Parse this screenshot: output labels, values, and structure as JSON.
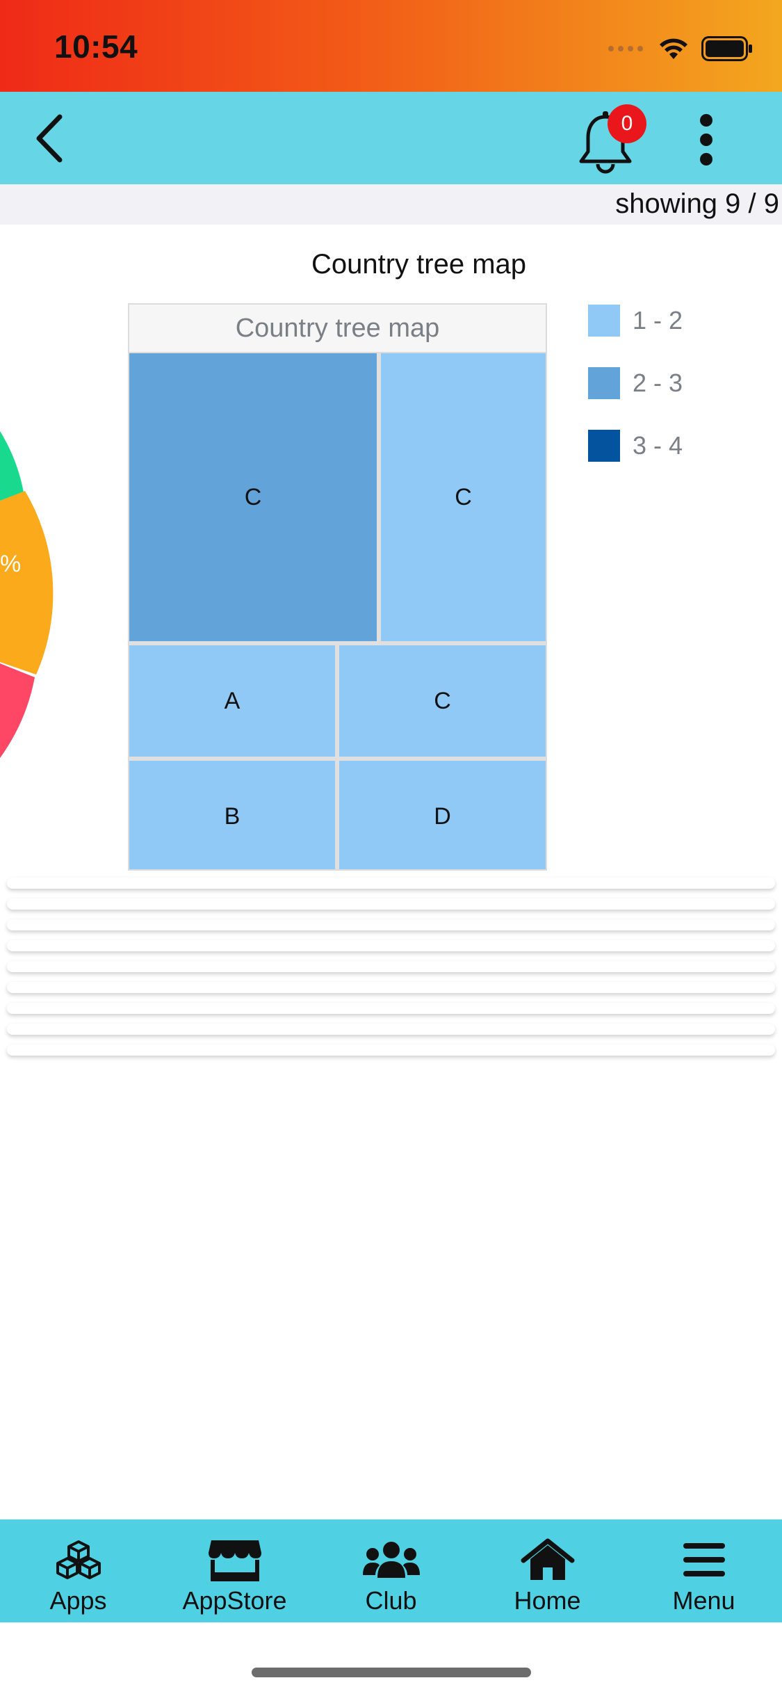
{
  "status_bar": {
    "time": "10:54"
  },
  "header": {
    "notification_count": "0"
  },
  "list": {
    "showing_text": "showing 9 / 9"
  },
  "pie_partial": {
    "visible_label": "%"
  },
  "chart_data": {
    "type": "treemap",
    "title": "Country tree map",
    "header_label": "Country tree map",
    "legend": [
      {
        "label": "1 - 2",
        "color": "#90c8f6"
      },
      {
        "label": "2 - 3",
        "color": "#62a4d9"
      },
      {
        "label": "3 - 4",
        "color": "#04539e"
      }
    ],
    "cells": [
      {
        "label": "C",
        "color_group": "2 - 3"
      },
      {
        "label": "C",
        "color_group": "1 - 2"
      },
      {
        "label": "A",
        "color_group": "1 - 2"
      },
      {
        "label": "C",
        "color_group": "1 - 2"
      },
      {
        "label": "B",
        "color_group": "1 - 2"
      },
      {
        "label": "D",
        "color_group": "1 - 2"
      }
    ]
  },
  "tabbar": {
    "items": [
      {
        "label": "Apps",
        "icon": "cubes-icon"
      },
      {
        "label": "AppStore",
        "icon": "store-icon"
      },
      {
        "label": "Club",
        "icon": "users-icon"
      },
      {
        "label": "Home",
        "icon": "home-icon"
      },
      {
        "label": "Menu",
        "icon": "menu-icon"
      }
    ]
  },
  "colors": {
    "status_bar_start": "#ef2a17",
    "status_bar_end": "#f3a71f",
    "header_bg": "#66d6e6",
    "tabbar_bg": "#4fd1e3",
    "badge": "#e9161b"
  }
}
